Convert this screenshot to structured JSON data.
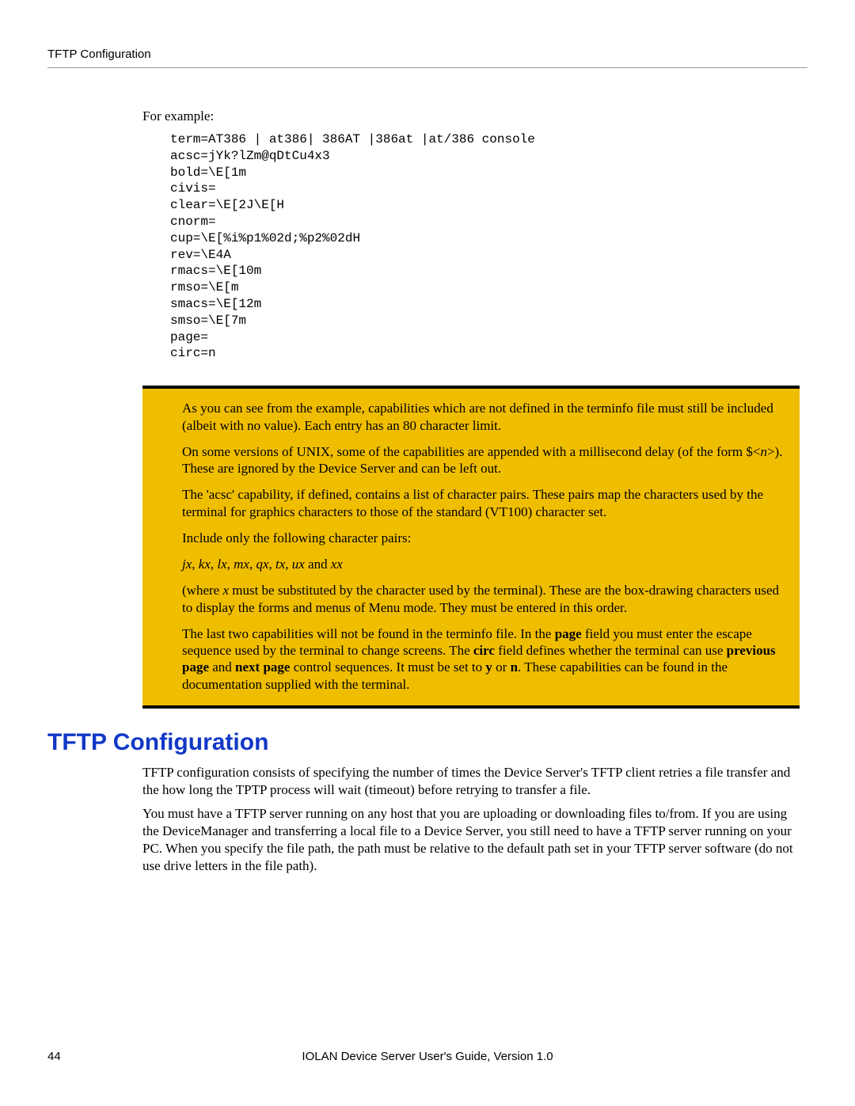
{
  "running_head": "TFTP Configuration",
  "example_label": "For example:",
  "code_lines": "term=AT386 | at386| 386AT |386at |at/386 console\nacsc=jYk?lZm@qDtCu4x3\nbold=\\E[1m\ncivis=\nclear=\\E[2J\\E[H\ncnorm=\ncup=\\E[%i%p1%02d;%p2%02dH\nrev=\\E4A\nrmacs=\\E[10m\nrmso=\\E[m\nsmacs=\\E[12m\nsmso=\\E[7m\npage=\ncirc=n",
  "note": {
    "p1": "As you can see from the example, capabilities which are not defined in the terminfo file must still be included (albeit with no value). Each entry has an 80 character limit.",
    "p2a": "On some versions of UNIX, some of the capabilities are appended with a millisecond delay (of the form $<",
    "p2_n": "n",
    "p2b": ">). These are ignored by the Device Server and can be left out.",
    "p3": "The 'acsc' capability, if defined, contains a list of character pairs. These pairs map the characters used by the terminal for graphics characters to those of the standard (VT100) character set.",
    "p4": "Include only the following character pairs:",
    "p5_italic": "jx, kx, lx, mx, qx, tx, ux ",
    "p5_and": "and ",
    "p5_xx": "xx",
    "p6a": "(where ",
    "p6_x": "x",
    "p6b": " must be substituted by the character used by the terminal). These are the box-drawing characters used to display the forms and menus of Menu mode. They must be entered in this order.",
    "p7a": "The last two capabilities will not be found in the terminfo file. In the ",
    "p7_page": "page",
    "p7b": " field you must enter the escape sequence used by the terminal to change screens. The ",
    "p7_circ": "circ",
    "p7c": " field defines whether the terminal can use ",
    "p7_prev": "previous page",
    "p7d": " and ",
    "p7_next": "next page",
    "p7e": " control sequences. It must be set to ",
    "p7_y": "y",
    "p7f": " or ",
    "p7_n": "n",
    "p7g": ". These capabilities can be found in the documentation supplied with the terminal."
  },
  "h1": "TFTP Configuration",
  "body_p1": "TFTP configuration consists of specifying the number of times the Device Server's TFTP client retries a file transfer and the how long the TPTP process will wait (timeout) before retrying to transfer a file.",
  "body_p2": "You must have a TFTP server running on any host that you are uploading or downloading files to/from. If you are using the DeviceManager and transferring a local file to a Device Server, you still need to have a TFTP server running on your PC. When you specify the file path, the path must be relative to the default path set in your TFTP server software (do not use drive letters in the file path).",
  "footer": {
    "page_num": "44",
    "title": "IOLAN Device Server User's Guide, Version 1.0"
  }
}
